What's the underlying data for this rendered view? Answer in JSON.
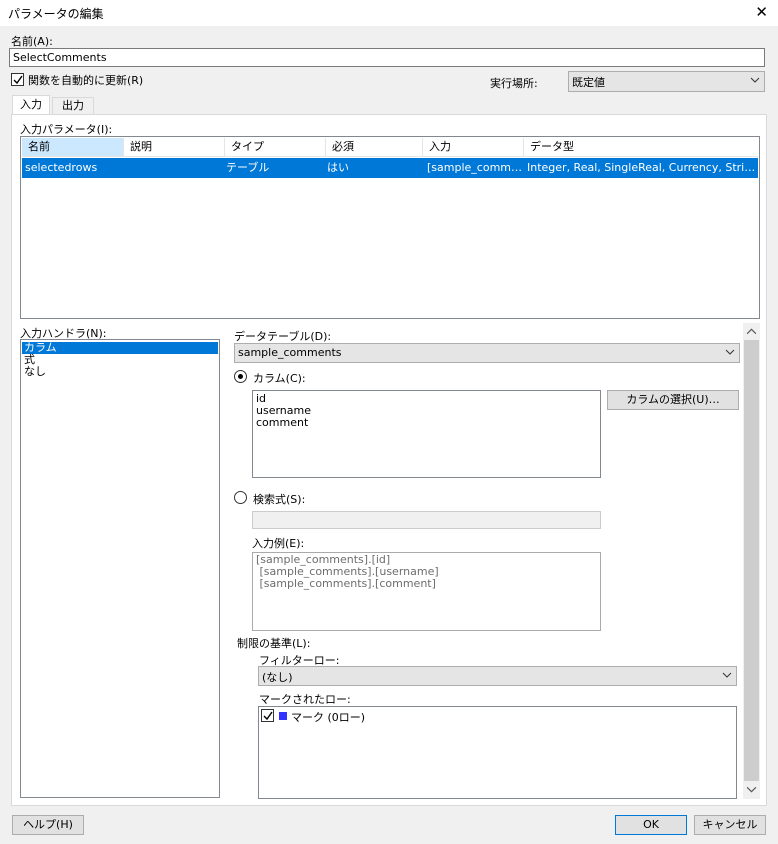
{
  "window": {
    "title": "パラメータの編集"
  },
  "name_section": {
    "label": "名前(A):",
    "value": "SelectComments",
    "auto_update_label": "関数を自動的に更新(R)",
    "auto_update_checked": true,
    "exec_location_label": "実行場所:",
    "exec_location_value": "既定値"
  },
  "tabs": [
    {
      "label": "入力",
      "active": true
    },
    {
      "label": "出力",
      "active": false
    }
  ],
  "input_params": {
    "label": "入力パラメータ(I):",
    "columns": [
      "名前",
      "説明",
      "タイプ",
      "必須",
      "入力",
      "データ型"
    ],
    "rows": [
      {
        "name": "selectedrows",
        "description": "",
        "type": "テーブル",
        "required": "はい",
        "input": "[sample_commen...",
        "data_type": "Integer, Real, SingleReal, Currency, String, Da..."
      }
    ]
  },
  "input_handler": {
    "label": "入力ハンドラ(N):",
    "items": [
      "カラム",
      "式",
      "なし"
    ],
    "selected_index": 0
  },
  "details": {
    "data_table_label": "データテーブル(D):",
    "data_table_value": "sample_comments",
    "column_radio_label": "カラム(C):",
    "columns": [
      "id",
      "username",
      "comment"
    ],
    "select_columns_button": "カラムの選択(U)…",
    "search_expr_label": "検索式(S):",
    "search_expr_value": "",
    "example_label": "入力例(E):",
    "example_lines": [
      "[sample_comments].[id]",
      " [sample_comments].[username]",
      " [sample_comments].[comment]"
    ],
    "limit_label": "制限の基準(L):",
    "filter_rows_label": "フィルターロー:",
    "filter_rows_value": "(なし)",
    "marked_rows_label": "マークされたロー:",
    "mark_item_label": "マーク (0ロー)",
    "mark_item_checked": true,
    "mark_color": "#3333ff"
  },
  "footer": {
    "help_button": "ヘルプ(H)",
    "ok_button": "OK",
    "cancel_button": "キャンセル"
  },
  "colors": {
    "selection": "#0078d7",
    "header_selected": "#cce8ff",
    "dialog_bg": "#f0f0f0"
  }
}
